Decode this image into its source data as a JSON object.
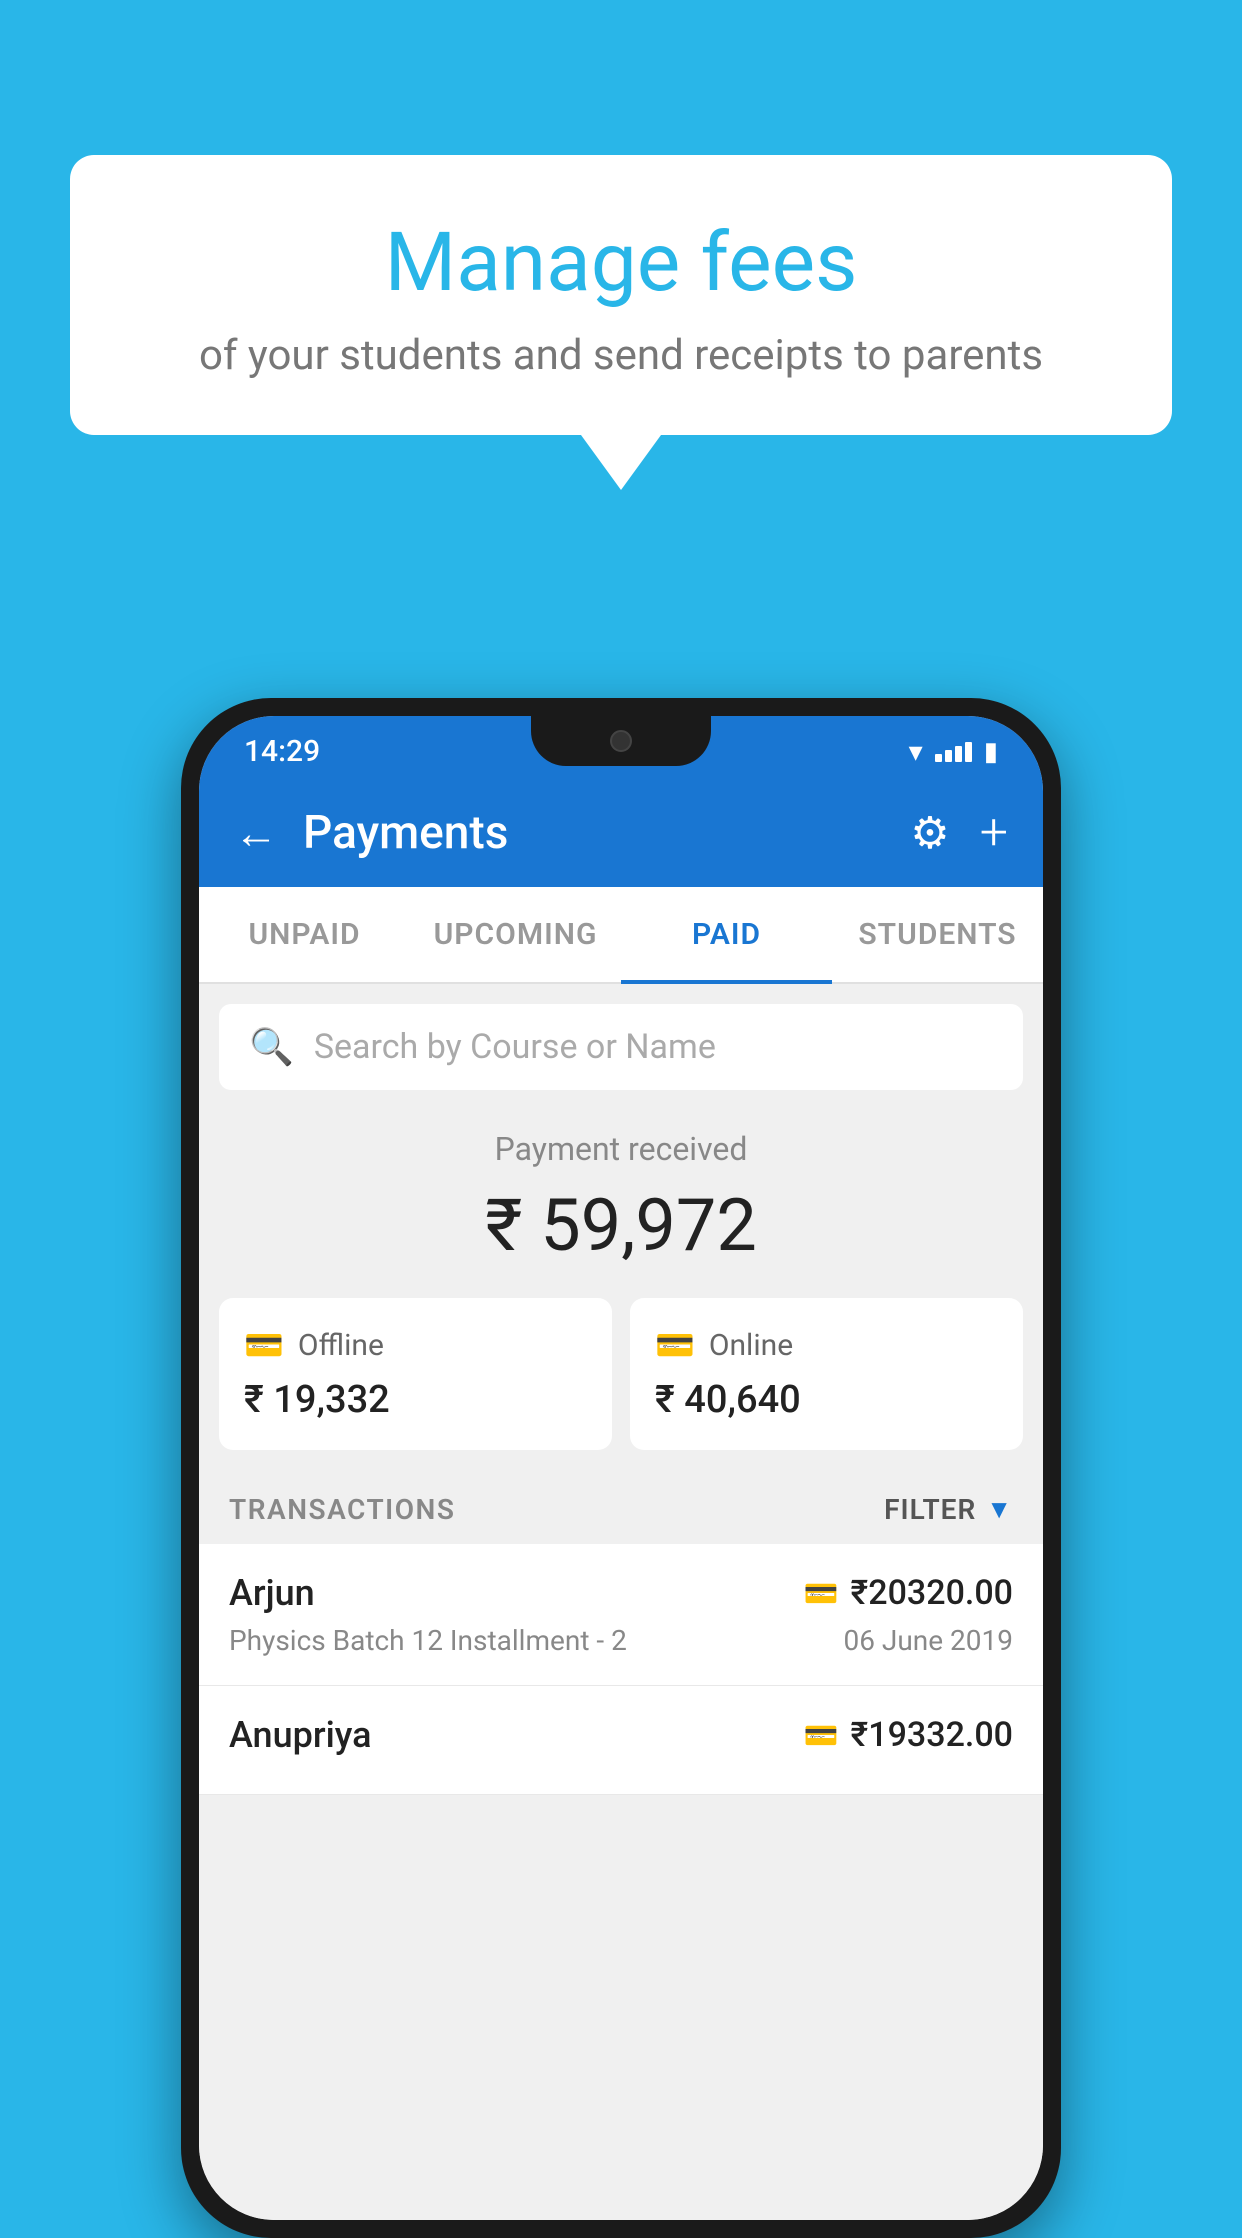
{
  "page": {
    "background_color": "#29B6E8"
  },
  "speech_bubble": {
    "title": "Manage fees",
    "subtitle": "of your students and send receipts to parents"
  },
  "status_bar": {
    "time": "14:29"
  },
  "app_bar": {
    "title": "Payments",
    "back_label": "←",
    "settings_label": "⚙",
    "add_label": "+"
  },
  "tabs": [
    {
      "label": "UNPAID",
      "active": false
    },
    {
      "label": "UPCOMING",
      "active": false
    },
    {
      "label": "PAID",
      "active": true
    },
    {
      "label": "STUDENTS",
      "active": false
    }
  ],
  "search": {
    "placeholder": "Search by Course or Name"
  },
  "payment_summary": {
    "label": "Payment received",
    "total": "₹ 59,972",
    "offline": {
      "label": "Offline",
      "amount": "₹ 19,332"
    },
    "online": {
      "label": "Online",
      "amount": "₹ 40,640"
    }
  },
  "transactions": {
    "header_label": "TRANSACTIONS",
    "filter_label": "FILTER",
    "items": [
      {
        "name": "Arjun",
        "course": "Physics Batch 12 Installment - 2",
        "amount": "₹20320.00",
        "date": "06 June 2019",
        "mode": "online"
      },
      {
        "name": "Anupriya",
        "course": "",
        "amount": "₹19332.00",
        "date": "",
        "mode": "offline"
      }
    ]
  }
}
